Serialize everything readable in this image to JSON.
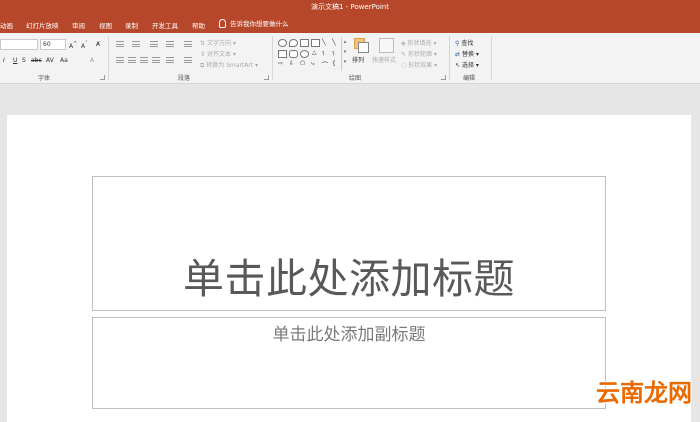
{
  "title_bar": {
    "text": "演示文稿1 - PowerPoint"
  },
  "menu": {
    "tabs": [
      "动画",
      "幻灯片放映",
      "审阅",
      "视图",
      "录制",
      "开发工具",
      "帮助"
    ],
    "tell_me": "告诉我你想要做什么"
  },
  "ribbon": {
    "font": {
      "size": "60",
      "label": "字体"
    },
    "paragraph": {
      "label": "段落",
      "text_direction": "文字方向",
      "align_text": "对齐文本",
      "smartart": "转换为 SmartArt"
    },
    "drawing": {
      "label": "绘图",
      "arrange": "排列",
      "quick_styles": "快速样式",
      "shape_fill": "形状填充",
      "shape_outline": "形状轮廓",
      "shape_effects": "形状效果"
    },
    "editing": {
      "label": "编辑",
      "find": "查找",
      "replace": "替换",
      "select": "选择"
    }
  },
  "slide": {
    "title_placeholder": "单击此处添加标题",
    "subtitle_placeholder": "单击此处添加副标题"
  },
  "watermark": "云南龙网",
  "colors": {
    "accent": "#b7472a",
    "ribbon_bg": "#f3f3f3",
    "workspace_bg": "#e6e6e6",
    "watermark": "#e86a00"
  }
}
